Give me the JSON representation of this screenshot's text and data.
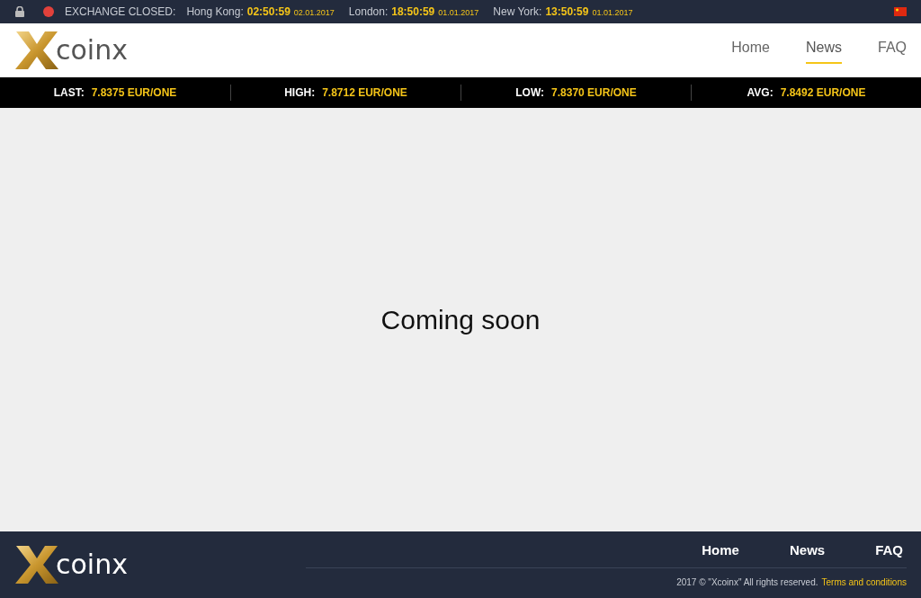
{
  "top_bar": {
    "exchange_open": false,
    "status_label": "EXCHANGE CLOSED:",
    "clocks": [
      {
        "city": "Hong Kong:",
        "time": "02:50:59",
        "date": "02.01.2017"
      },
      {
        "city": "London:",
        "time": "18:50:59",
        "date": "01.01.2017"
      },
      {
        "city": "New York:",
        "time": "13:50:59",
        "date": "01.01.2017"
      }
    ]
  },
  "header": {
    "logo_text": "coinx",
    "nav": [
      {
        "label": "Home",
        "selected": false
      },
      {
        "label": "News",
        "selected": true
      },
      {
        "label": "FAQ",
        "selected": false
      }
    ]
  },
  "ticker": [
    {
      "label": "LAST:",
      "value": "7.8375 EUR/ONE"
    },
    {
      "label": "HIGH:",
      "value": "7.8712 EUR/ONE"
    },
    {
      "label": "LOW:",
      "value": "7.8370 EUR/ONE"
    },
    {
      "label": "AVG:",
      "value": "7.8492 EUR/ONE"
    }
  ],
  "content": {
    "message": "Coming soon"
  },
  "footer": {
    "logo_text": "coinx",
    "nav": [
      "Home",
      "News",
      "FAQ"
    ],
    "copyright": "2017 © \"Xcoinx\" All rights reserved.",
    "terms_link": "Terms and conditions"
  }
}
